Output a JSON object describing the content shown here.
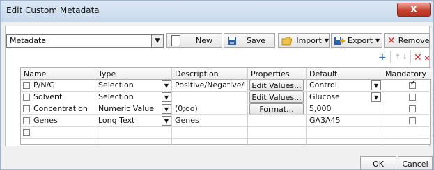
{
  "window": {
    "title": "Edit Custom Metadata",
    "close_label": "X"
  },
  "toolbar": {
    "metadata_value": "Metadata",
    "new_label": "New",
    "save_label": "Save",
    "import_label": "Import",
    "export_label": "Export",
    "remove_label": "Remove"
  },
  "table": {
    "columns": [
      "Name",
      "Type",
      "Description",
      "Properties",
      "Default",
      "Mandatory"
    ],
    "rows": [
      {
        "name": "P/N/C",
        "type": "Selection",
        "description": "Positive/Negative/C...",
        "properties": "Edit Values...",
        "default": "Control",
        "mandatory": true
      },
      {
        "name": "Solvent",
        "type": "Selection",
        "description": "",
        "properties": "Edit Values...",
        "default": "Glucose",
        "mandatory": false
      },
      {
        "name": "Concentration",
        "type": "Numeric Value",
        "description": "(0;oo)",
        "properties": "Format...",
        "default": "5,000",
        "mandatory": false
      },
      {
        "name": "Genes",
        "type": "Long Text",
        "description": "Genes",
        "properties": "",
        "default": "GA3A45",
        "mandatory": false
      }
    ]
  },
  "buttons": {
    "ok_label": "OK",
    "cancel_label": "Cancel"
  },
  "colors": {
    "accent_red": "#d32f2f",
    "add_blue": "#2f6fbf"
  }
}
